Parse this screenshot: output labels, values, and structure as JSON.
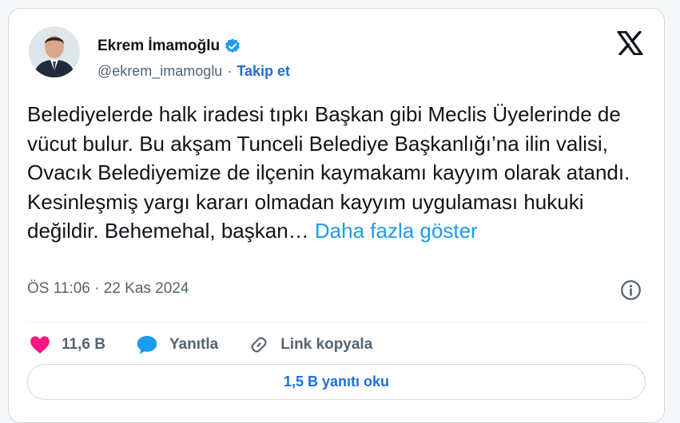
{
  "author": {
    "name": "Ekrem İmamoğlu",
    "handle": "@ekrem_imamoglu",
    "separator": "·",
    "follow_label": "Takip et"
  },
  "tweet": {
    "text": "Belediyelerde halk iradesi tıpkı Başkan gibi Meclis Üyelerinde de vücut bulur. Bu akşam Tunceli Belediye Başkanlığı’na ilin valisi, Ovacık Belediyemize de ilçenin kaymakamı kayyım olarak atandı. Kesinleşmiş yargı kararı olmadan kayyım uygulaması hukuki değildir. Behemehal, başkan…",
    "show_more_label": "Daha fazla göster",
    "timestamp": "ÖS 11:06 · 22 Kas 2024"
  },
  "actions": {
    "like_count": "11,6 B",
    "reply_label": "Yanıtla",
    "copy_link_label": "Link kopyala"
  },
  "read_replies_label": "1,5 B yanıtı oku",
  "colors": {
    "accent_link": "#1d9bf0",
    "follow_blue": "#1d6fd8",
    "heart": "#f91880",
    "reply_bubble": "#1d9bf0",
    "verified": "#1d9bf0"
  },
  "icons": [
    "verified-badge-icon",
    "x-logo-icon",
    "info-icon",
    "heart-icon",
    "reply-icon",
    "link-icon"
  ]
}
